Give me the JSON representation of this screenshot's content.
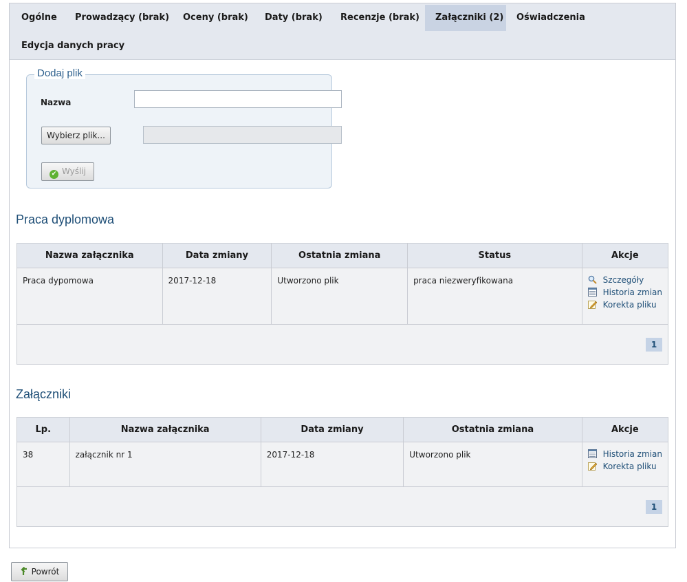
{
  "tabs": [
    {
      "label": "Ogólne"
    },
    {
      "label": "Prowadzący (brak)"
    },
    {
      "label": "Oceny (brak)"
    },
    {
      "label": "Daty (brak)"
    },
    {
      "label": "Recenzje (brak)"
    },
    {
      "label": "Załączniki (2)",
      "active": true
    },
    {
      "label": "Oświadczenia"
    },
    {
      "label": "Edycja danych pracy"
    }
  ],
  "upload": {
    "legend": "Dodaj plik",
    "name_label": "Nazwa",
    "name_value": "",
    "choose_file_label": "Wybierz plik...",
    "file_value": "",
    "send_label": "Wyślij"
  },
  "thesis": {
    "title": "Praca dyplomowa",
    "headers": [
      "Nazwa załącznika",
      "Data zmiany",
      "Ostatnia zmiana",
      "Status",
      "Akcje"
    ],
    "rows": [
      {
        "name": "Praca dypomowa",
        "date": "2017-12-18",
        "last_change": "Utworzono plik",
        "status": "praca niezweryfikowana",
        "actions": [
          "Szczegóły",
          "Historia zmian",
          "Korekta pliku"
        ]
      }
    ],
    "page": "1"
  },
  "attachments": {
    "title": "Załączniki",
    "headers": [
      "Lp.",
      "Nazwa załącznika",
      "Data zmiany",
      "Ostatnia zmiana",
      "Akcje"
    ],
    "rows": [
      {
        "lp": "38",
        "name": "załącznik nr 1",
        "date": "2017-12-18",
        "last_change": "Utworzono plik",
        "actions": [
          "Historia zmian",
          "Korekta pliku"
        ]
      }
    ],
    "page": "1"
  },
  "back_label": "Powrót",
  "icons": {
    "details": "magnifier-icon",
    "history": "history-list-icon",
    "edit": "pencil-edit-icon",
    "send": "check-circle-icon",
    "back": "return-arrow-icon"
  },
  "colors": {
    "tab_bar": "#e4e8ef",
    "tab_active": "#c9d3e3",
    "heading": "#1f4f77",
    "link": "#1f4f77"
  }
}
